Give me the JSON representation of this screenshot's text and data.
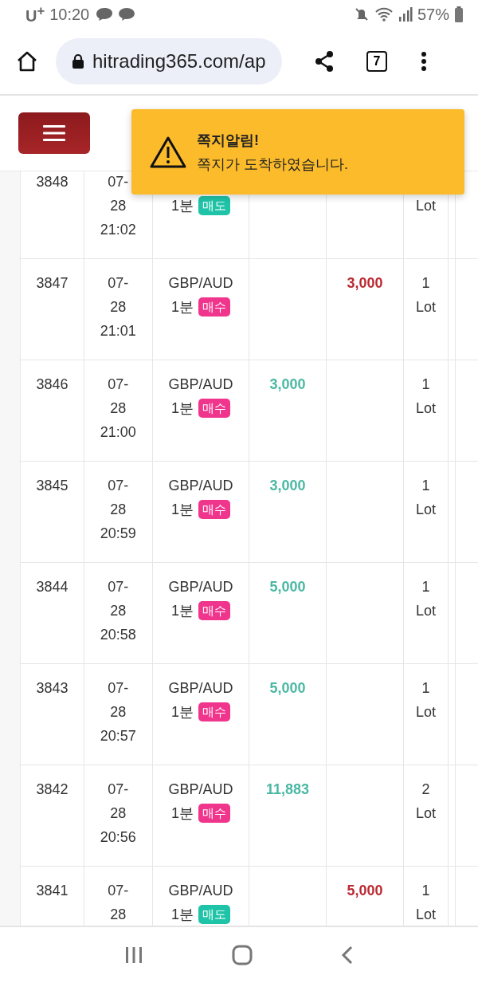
{
  "status_bar": {
    "carrier": "U$^{+}$",
    "time": "10:20",
    "battery": "57%"
  },
  "browser": {
    "url": "hitrading365.com/ap",
    "tab_count": "7"
  },
  "toast": {
    "title": "쪽지알림!",
    "message": "쪽지가 도착하였습니다."
  },
  "rows": [
    {
      "id": "3848",
      "date": "07-28",
      "time": "21:02",
      "period": "1분",
      "side": {
        "label": "매도",
        "kind": "sell"
      },
      "lot_unit": "Lot"
    },
    {
      "id": "3847",
      "date": "07-28",
      "time": "21:01",
      "pair": "GBP/AUD",
      "period": "1분",
      "side": {
        "label": "매수",
        "kind": "buy"
      },
      "column_4": "",
      "column_5": "3,000",
      "lot_count": "1",
      "lot_unit": "Lot"
    },
    {
      "id": "3846",
      "date": "07-28",
      "time": "21:00",
      "pair": "GBP/AUD",
      "period": "1분",
      "side": {
        "label": "매수",
        "kind": "buy"
      },
      "column_4": "3,000",
      "column_5": "",
      "lot_count": "1",
      "lot_unit": "Lot"
    },
    {
      "id": "3845",
      "date": "07-28",
      "time": "20:59",
      "pair": "GBP/AUD",
      "period": "1분",
      "side": {
        "label": "매수",
        "kind": "buy"
      },
      "column_4": "3,000",
      "column_5": "",
      "lot_count": "1",
      "lot_unit": "Lot"
    },
    {
      "id": "3844",
      "date": "07-28",
      "time": "20:58",
      "pair": "GBP/AUD",
      "period": "1분",
      "side": {
        "label": "매수",
        "kind": "buy"
      },
      "column_4": "5,000",
      "column_5": "",
      "lot_count": "1",
      "lot_unit": "Lot"
    },
    {
      "id": "3843",
      "date": "07-28",
      "time": "20:57",
      "pair": "GBP/AUD",
      "period": "1분",
      "side": {
        "label": "매수",
        "kind": "buy"
      },
      "column_4": "5,000",
      "column_5": "",
      "lot_count": "1",
      "lot_unit": "Lot"
    },
    {
      "id": "3842",
      "date": "07-28",
      "time": "20:56",
      "pair": "GBP/AUD",
      "period": "1분",
      "side": {
        "label": "매수",
        "kind": "buy"
      },
      "column_4": "11,883",
      "column_5": "",
      "lot_count": "2",
      "lot_unit": "Lot"
    },
    {
      "id": "3841",
      "date": "07-28",
      "pair": "GBP/AUD",
      "period": "1분",
      "side": {
        "label": "매도",
        "kind": "sell"
      },
      "column_4": "",
      "column_5": "5,000",
      "lot_count": "1",
      "lot_unit": "Lot"
    }
  ]
}
